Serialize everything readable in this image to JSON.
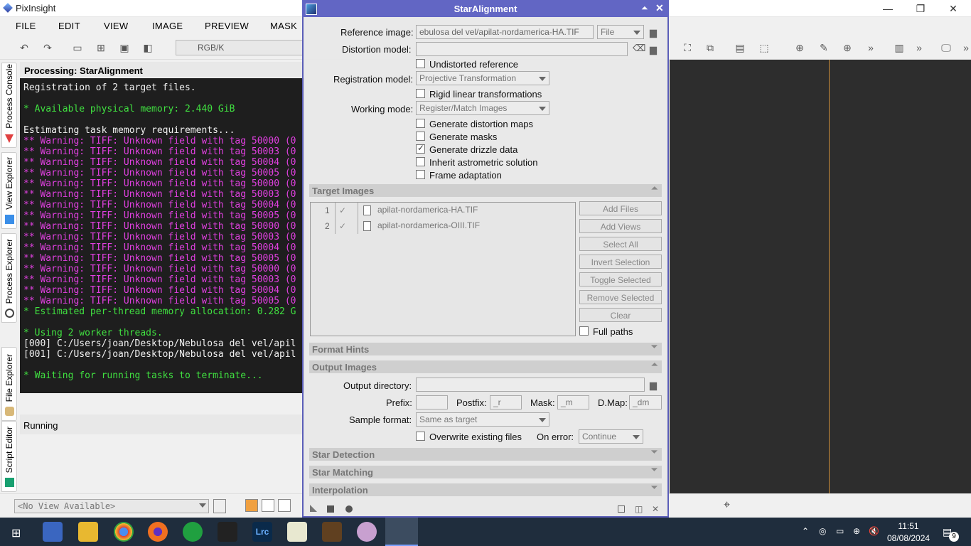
{
  "window": {
    "title": "PixInsight",
    "min": "—",
    "restore": "❐",
    "close": "✕"
  },
  "menu": [
    "FILE",
    "EDIT",
    "VIEW",
    "IMAGE",
    "PREVIEW",
    "MASK"
  ],
  "toolbar": {
    "colorspace": "RGB/K"
  },
  "sidebar": {
    "tabs": [
      "Process Console",
      "View Explorer",
      "Process Explorer",
      "File Explorer",
      "Script Editor"
    ]
  },
  "console": {
    "header": "Processing: StarAlignment",
    "lines": [
      {
        "c": "n",
        "t": "Registration of 2 target files."
      },
      {
        "c": "n",
        "t": ""
      },
      {
        "c": "g",
        "t": "* Available physical memory: 2.440 GiB"
      },
      {
        "c": "n",
        "t": ""
      },
      {
        "c": "n",
        "t": "Estimating task memory requirements..."
      },
      {
        "c": "w",
        "t": "** Warning: TIFF: Unknown field with tag 50000 (0"
      },
      {
        "c": "w",
        "t": "** Warning: TIFF: Unknown field with tag 50003 (0"
      },
      {
        "c": "w",
        "t": "** Warning: TIFF: Unknown field with tag 50004 (0"
      },
      {
        "c": "w",
        "t": "** Warning: TIFF: Unknown field with tag 50005 (0"
      },
      {
        "c": "w",
        "t": "** Warning: TIFF: Unknown field with tag 50000 (0"
      },
      {
        "c": "w",
        "t": "** Warning: TIFF: Unknown field with tag 50003 (0"
      },
      {
        "c": "w",
        "t": "** Warning: TIFF: Unknown field with tag 50004 (0"
      },
      {
        "c": "w",
        "t": "** Warning: TIFF: Unknown field with tag 50005 (0"
      },
      {
        "c": "w",
        "t": "** Warning: TIFF: Unknown field with tag 50000 (0"
      },
      {
        "c": "w",
        "t": "** Warning: TIFF: Unknown field with tag 50003 (0"
      },
      {
        "c": "w",
        "t": "** Warning: TIFF: Unknown field with tag 50004 (0"
      },
      {
        "c": "w",
        "t": "** Warning: TIFF: Unknown field with tag 50005 (0"
      },
      {
        "c": "w",
        "t": "** Warning: TIFF: Unknown field with tag 50000 (0"
      },
      {
        "c": "w",
        "t": "** Warning: TIFF: Unknown field with tag 50003 (0"
      },
      {
        "c": "w",
        "t": "** Warning: TIFF: Unknown field with tag 50004 (0"
      },
      {
        "c": "w",
        "t": "** Warning: TIFF: Unknown field with tag 50005 (0"
      },
      {
        "c": "g",
        "t": "* Estimated per-thread memory allocation: 0.282 G"
      },
      {
        "c": "n",
        "t": ""
      },
      {
        "c": "g",
        "t": "* Using 2 worker threads."
      },
      {
        "c": "n",
        "t": "[000] C:/Users/joan/Desktop/Nebulosa del vel/apil"
      },
      {
        "c": "n",
        "t": "[001] C:/Users/joan/Desktop/Nebulosa del vel/apil"
      },
      {
        "c": "n",
        "t": ""
      },
      {
        "c": "g",
        "t": "* Waiting for running tasks to terminate..."
      }
    ],
    "status": "Running"
  },
  "bottom": {
    "view_combo": "<No View Available>"
  },
  "dialog": {
    "title": "StarAlignment",
    "reference_label": "Reference image:",
    "reference_value": "ebulosa del vel/apilat-nordamerica-HA.TIF",
    "reference_mode": "File",
    "distortion_label": "Distortion model:",
    "undistorted": "Undistorted reference",
    "registration_label": "Registration model:",
    "registration_value": "Projective Transformation",
    "rigid": "Rigid linear transformations",
    "working_label": "Working mode:",
    "working_value": "Register/Match Images",
    "gen_maps": "Generate distortion maps",
    "gen_masks": "Generate masks",
    "gen_drizzle": "Generate drizzle data",
    "inherit": "Inherit astrometric solution",
    "frame_adapt": "Frame adaptation",
    "target_section": "Target Images",
    "targets": [
      {
        "n": "1",
        "file": "apilat-nordamerica-HA.TIF"
      },
      {
        "n": "2",
        "file": "apilat-nordamerica-OIII.TIF"
      }
    ],
    "buttons": [
      "Add Files",
      "Add Views",
      "Select All",
      "Invert Selection",
      "Toggle Selected",
      "Remove Selected",
      "Clear"
    ],
    "full_paths": "Full paths",
    "format_section": "Format Hints",
    "output_section": "Output Images",
    "outdir_label": "Output directory:",
    "prefix_label": "Prefix:",
    "postfix_label": "Postfix:",
    "postfix_value": "_r",
    "mask_label": "Mask:",
    "mask_value": "_m",
    "dmap_label": "D.Map:",
    "dmap_value": "_dm",
    "sample_label": "Sample format:",
    "sample_value": "Same as target",
    "overwrite": "Overwrite existing files",
    "onerror_label": "On error:",
    "onerror_value": "Continue",
    "star_detection": "Star Detection",
    "star_matching": "Star Matching",
    "interpolation": "Interpolation"
  },
  "taskbar": {
    "time": "11:51",
    "date": "08/08/2024",
    "notifications": "9"
  }
}
